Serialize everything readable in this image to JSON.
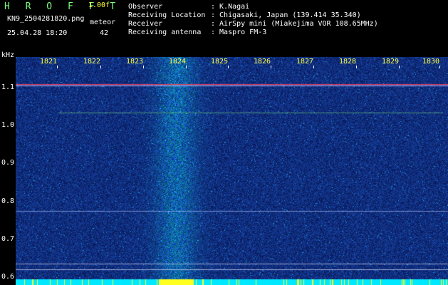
{
  "header": {
    "title": "H R O F F T",
    "version": "1.00f",
    "filename": "KN9_2504281820.png",
    "mode": "meteor",
    "datetime": "25.04.28 18:20",
    "count": "42"
  },
  "info": [
    {
      "label": "Observer",
      "value": ": K.Nagai"
    },
    {
      "label": "Receiving Location",
      "value": ": Chigasaki, Japan (139.414 35.340)"
    },
    {
      "label": "Receiver",
      "value": ": AirSpy mini (Miakejima VOR 108.65MHz)"
    },
    {
      "label": "Receiving antenna",
      "value": ": Maspro FM-3"
    }
  ],
  "axis": {
    "y_unit": "kHz",
    "y_ticks": [
      "1.1",
      "1.0",
      "0.9",
      "0.8",
      "0.7",
      "0.6"
    ],
    "y_values": [
      1.1,
      1.0,
      0.9,
      0.8,
      0.7,
      0.6
    ],
    "y_range": [
      0.58,
      1.18
    ],
    "x_ticks": [
      "1821",
      "1822",
      "1823",
      "1824",
      "1825",
      "1826",
      "1827",
      "1828",
      "1829",
      "1830"
    ]
  },
  "colors": {
    "background": "#0a1e6a",
    "signal": "#2b6cff",
    "header_title": "#7dff7d",
    "tick_label": "#ffff40"
  }
}
